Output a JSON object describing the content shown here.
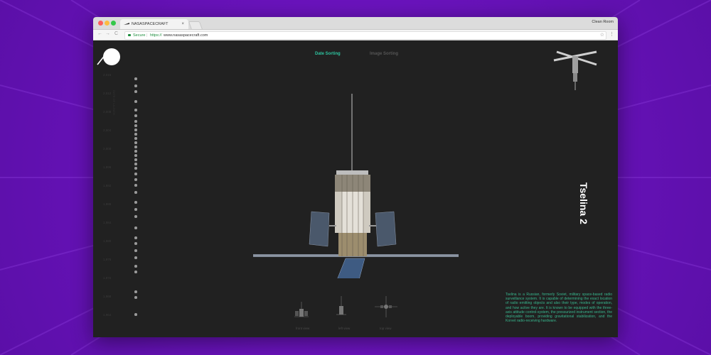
{
  "browser": {
    "tab_title": "NASASPACECRAFT",
    "tab_close": "×",
    "profile_name": "Clean Room",
    "security_label": "Secure",
    "url_scheme": "https://",
    "url_rest": "www.nasaspacecraft.com",
    "nav": {
      "back": "←",
      "forward": "→",
      "reload": "C"
    },
    "bookmark_icon": "star-icon",
    "menu_icon": "⋮"
  },
  "nav_tabs": [
    {
      "label": "Date Sorting",
      "active": true,
      "color": "#2ec4a0"
    },
    {
      "label": "Image Sorting",
      "active": false,
      "color": "#555555"
    }
  ],
  "timeline": {
    "axis_title": "DATE OF LAUNCH",
    "ticks": [
      "2,016",
      "2,012",
      "2,008",
      "2,004",
      "2,000",
      "1,996",
      "1,992",
      "1,988",
      "1,984",
      "1,980",
      "1,976",
      "1,972",
      "1,968",
      "1,964"
    ]
  },
  "satellite": {
    "name": "Tselina 2",
    "description": "Tselina is a Russian, formerly Soviet, military space-based radio surveillance system. It is capable of determining the exact location of radio emitting objects and also their type, modes of operation, and how active they are. It is known to be equipped with the three-axis attitude control-system, the pressurized instrument section, the deployable boom, providing gravitational stabilization, and the Korvet radio-receiving hardware.",
    "views": [
      {
        "label": "front view"
      },
      {
        "label": "left view"
      },
      {
        "label": "top view"
      }
    ]
  },
  "colors": {
    "accent": "#2ec4a0",
    "background": "#212121",
    "desktop": "#6a13bd"
  }
}
